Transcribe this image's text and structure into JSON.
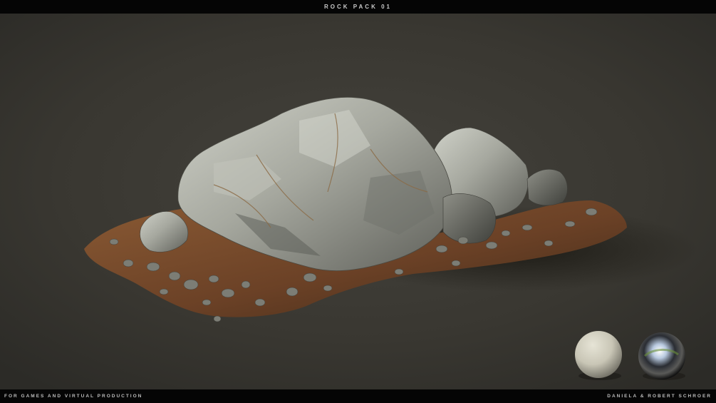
{
  "header": {
    "title": "ROCK PACK 01"
  },
  "footer": {
    "left_text": "FOR GAMES AND VIRTUAL PRODUCTION",
    "right_text": "DANIELA & ROBERT SCHROER"
  },
  "scene": {
    "subject": "rock formation on dirt patch",
    "background_color": "#3a3833",
    "preview_spheres": [
      "matte-sphere",
      "chrome-sphere"
    ]
  }
}
